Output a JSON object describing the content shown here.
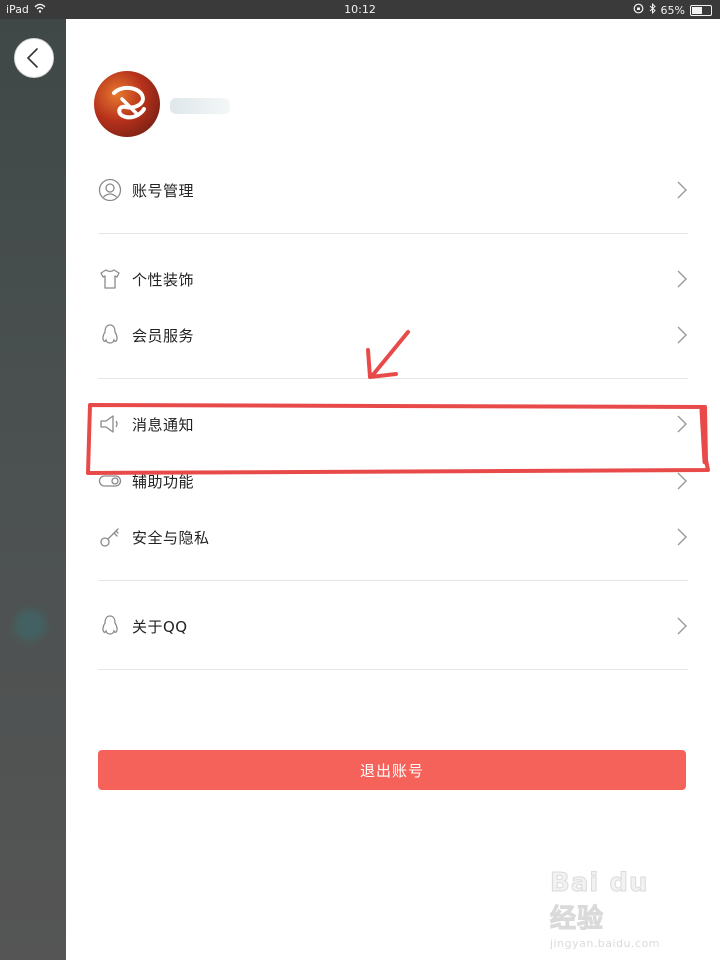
{
  "status_bar": {
    "device": "iPad",
    "time": "10:12",
    "battery": "65%",
    "battery_level": 0.65
  },
  "profile": {
    "nickname": ""
  },
  "menu": {
    "items": [
      {
        "label": "账号管理",
        "icon": "account-icon"
      },
      {
        "label": "个性装饰",
        "icon": "tshirt-icon"
      },
      {
        "label": "会员服务",
        "icon": "penguin-icon"
      },
      {
        "label": "消息通知",
        "icon": "speaker-icon"
      },
      {
        "label": "辅助功能",
        "icon": "toggle-icon"
      },
      {
        "label": "安全与隐私",
        "icon": "key-icon"
      },
      {
        "label": "关于QQ",
        "icon": "qq-icon"
      }
    ]
  },
  "logout": {
    "label": "退出账号"
  },
  "watermark": {
    "logo": "Bai du 经验",
    "url": "jingyan.baidu.com"
  },
  "colors": {
    "logout_bg": "#f56259",
    "annotation": "#e84a4a",
    "background_panel": "#4a5050"
  }
}
